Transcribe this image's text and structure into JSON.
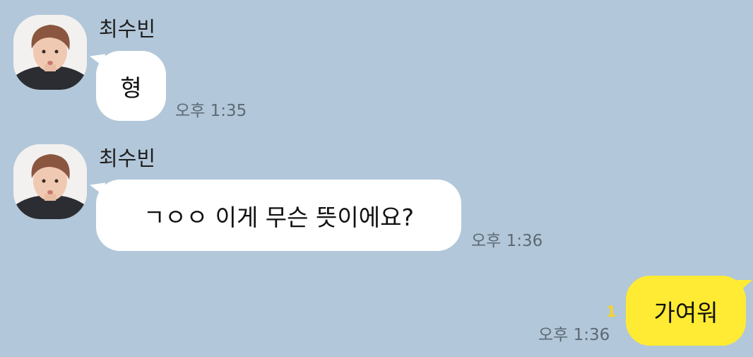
{
  "chat": {
    "messages": [
      {
        "sender": "최수빈",
        "text": "형",
        "time": "오후 1:35"
      },
      {
        "sender": "최수빈",
        "text": "ㄱㅇㅇ 이게 무슨 뜻이에요?",
        "time": "오후 1:36"
      },
      {
        "text": "가여워",
        "time": "오후 1:36",
        "unread_count": "1"
      }
    ]
  },
  "colors": {
    "background": "#b2c7d9",
    "incoming_bubble": "#ffffff",
    "outgoing_bubble": "#ffeb33",
    "unread": "#f5d42a"
  }
}
